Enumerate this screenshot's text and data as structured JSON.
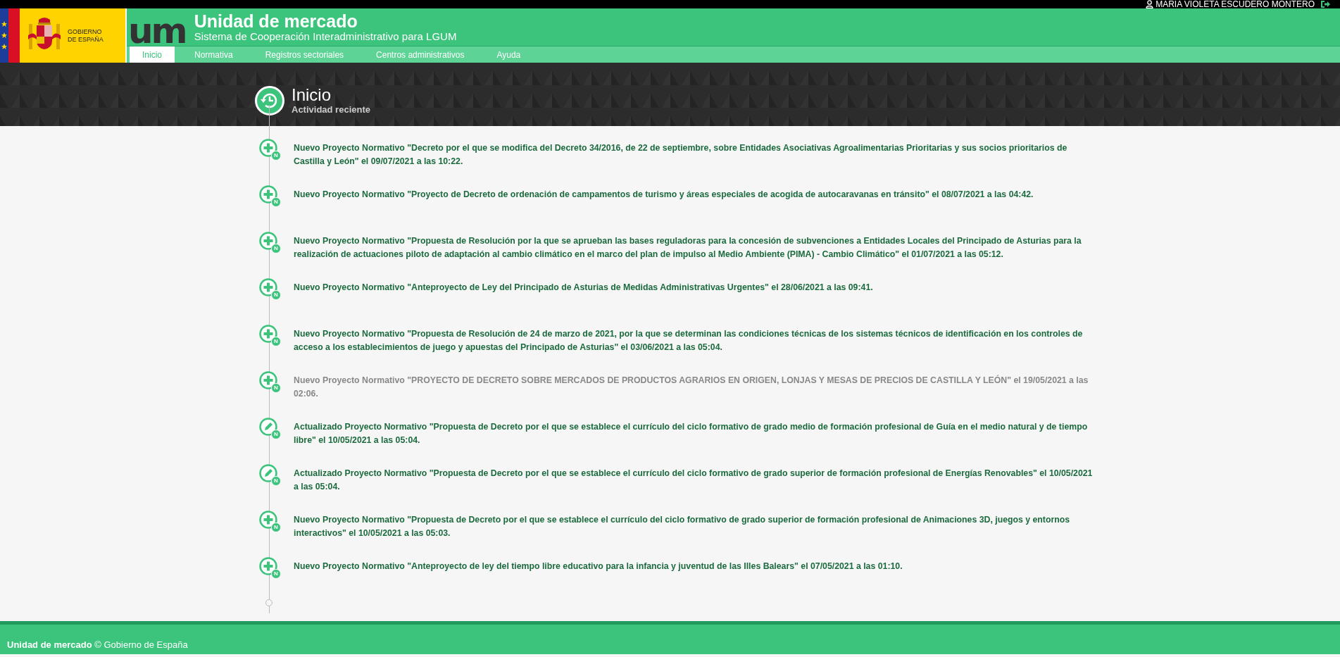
{
  "top_bar": {
    "user": "MARIA VIOLETA ESCUDERO MONTERO"
  },
  "government": {
    "lines": [
      "GOBIERNO",
      "DE ESPAÑA"
    ]
  },
  "header": {
    "logo": "um",
    "title": "Unidad de mercado",
    "subtitle": "Sistema de Cooperación Interadministrativo para LGUM"
  },
  "tabs": [
    {
      "label": "Inicio",
      "selected": true
    },
    {
      "label": "Normativa",
      "selected": false
    },
    {
      "label": "Registros sectoriales",
      "selected": false
    },
    {
      "label": "Centros administrativos",
      "selected": false
    },
    {
      "label": "Ayuda",
      "selected": false
    }
  ],
  "page": {
    "title": "Inicio",
    "subtitle": "Actividad reciente"
  },
  "activity": [
    {
      "kind": "new",
      "badge": "N",
      "greyed": false,
      "text": "Nuevo Proyecto Normativo \"Decreto por el que se modifica del Decreto 34/2016, de 22 de septiembre, sobre Entidades Asociativas Agroalimentarias Prioritarias y sus socios prioritarios de Castilla y León\" el 09/07/2021 a las 10:22."
    },
    {
      "kind": "new",
      "badge": "N",
      "greyed": false,
      "text": "Nuevo Proyecto Normativo \"Proyecto de Decreto de ordenación de campamentos de turismo y áreas especiales de acogida de autocaravanas en tránsito\" el 08/07/2021 a las 04:42."
    },
    {
      "kind": "new",
      "badge": "N",
      "greyed": false,
      "text": "Nuevo Proyecto Normativo \"Propuesta de Resolución por la que se aprueban las bases reguladoras para la concesión de subvenciones a Entidades Locales del Principado de Asturias para la realización de actuaciones piloto de adaptación al cambio climático en el marco del plan de impulso al Medio Ambiente (PIMA) - Cambio Climático\" el 01/07/2021 a las 05:12."
    },
    {
      "kind": "new",
      "badge": "N",
      "greyed": false,
      "text": "Nuevo Proyecto Normativo \"Anteproyecto de Ley del Principado de Asturias de Medidas Administrativas Urgentes\" el 28/06/2021 a las 09:41."
    },
    {
      "kind": "new",
      "badge": "N",
      "greyed": false,
      "text": "Nuevo Proyecto Normativo \"Propuesta de Resolución de 24 de marzo de 2021, por la que se determinan las condiciones técnicas de los sistemas técnicos de identificación en los controles de acceso a los establecimientos de juego y apuestas del Principado de Asturias\" el 03/06/2021 a las 05:04."
    },
    {
      "kind": "new",
      "badge": "N",
      "greyed": true,
      "text": "Nuevo Proyecto Normativo \"PROYECTO DE DECRETO SOBRE MERCADOS DE PRODUCTOS AGRARIOS EN ORIGEN, LONJAS Y MESAS DE PRECIOS DE CASTILLA Y LEÓN\" el 19/05/2021 a las 02:06."
    },
    {
      "kind": "updated",
      "badge": "N",
      "greyed": false,
      "text": "Actualizado Proyecto Normativo \"Propuesta de Decreto por el que se establece el currículo del ciclo formativo de grado medio de formación profesional de Guía en el medio natural y de tiempo libre\" el 10/05/2021 a las 05:04."
    },
    {
      "kind": "updated",
      "badge": "N",
      "greyed": false,
      "text": "Actualizado Proyecto Normativo \"Propuesta de Decreto por el que se establece el currículo del ciclo formativo de grado superior de formación profesional de Energías Renovables\" el 10/05/2021 a las 05:04."
    },
    {
      "kind": "new",
      "badge": "N",
      "greyed": false,
      "text": "Nuevo Proyecto Normativo \"Propuesta de Decreto por el que se establece el currículo del ciclo formativo de grado superior de formación profesional de Animaciones 3D, juegos y entornos interactivos\" el 10/05/2021 a las 05:03."
    },
    {
      "kind": "new",
      "badge": "N",
      "greyed": false,
      "text": "Nuevo Proyecto Normativo \"Anteproyecto de ley del tiempo libre educativo para la infancia y juventud de las Illes Balears\" el 07/05/2021 a las 01:10."
    }
  ],
  "footer": {
    "text": "**Unidad de mercado** © Gobierno de España"
  }
}
